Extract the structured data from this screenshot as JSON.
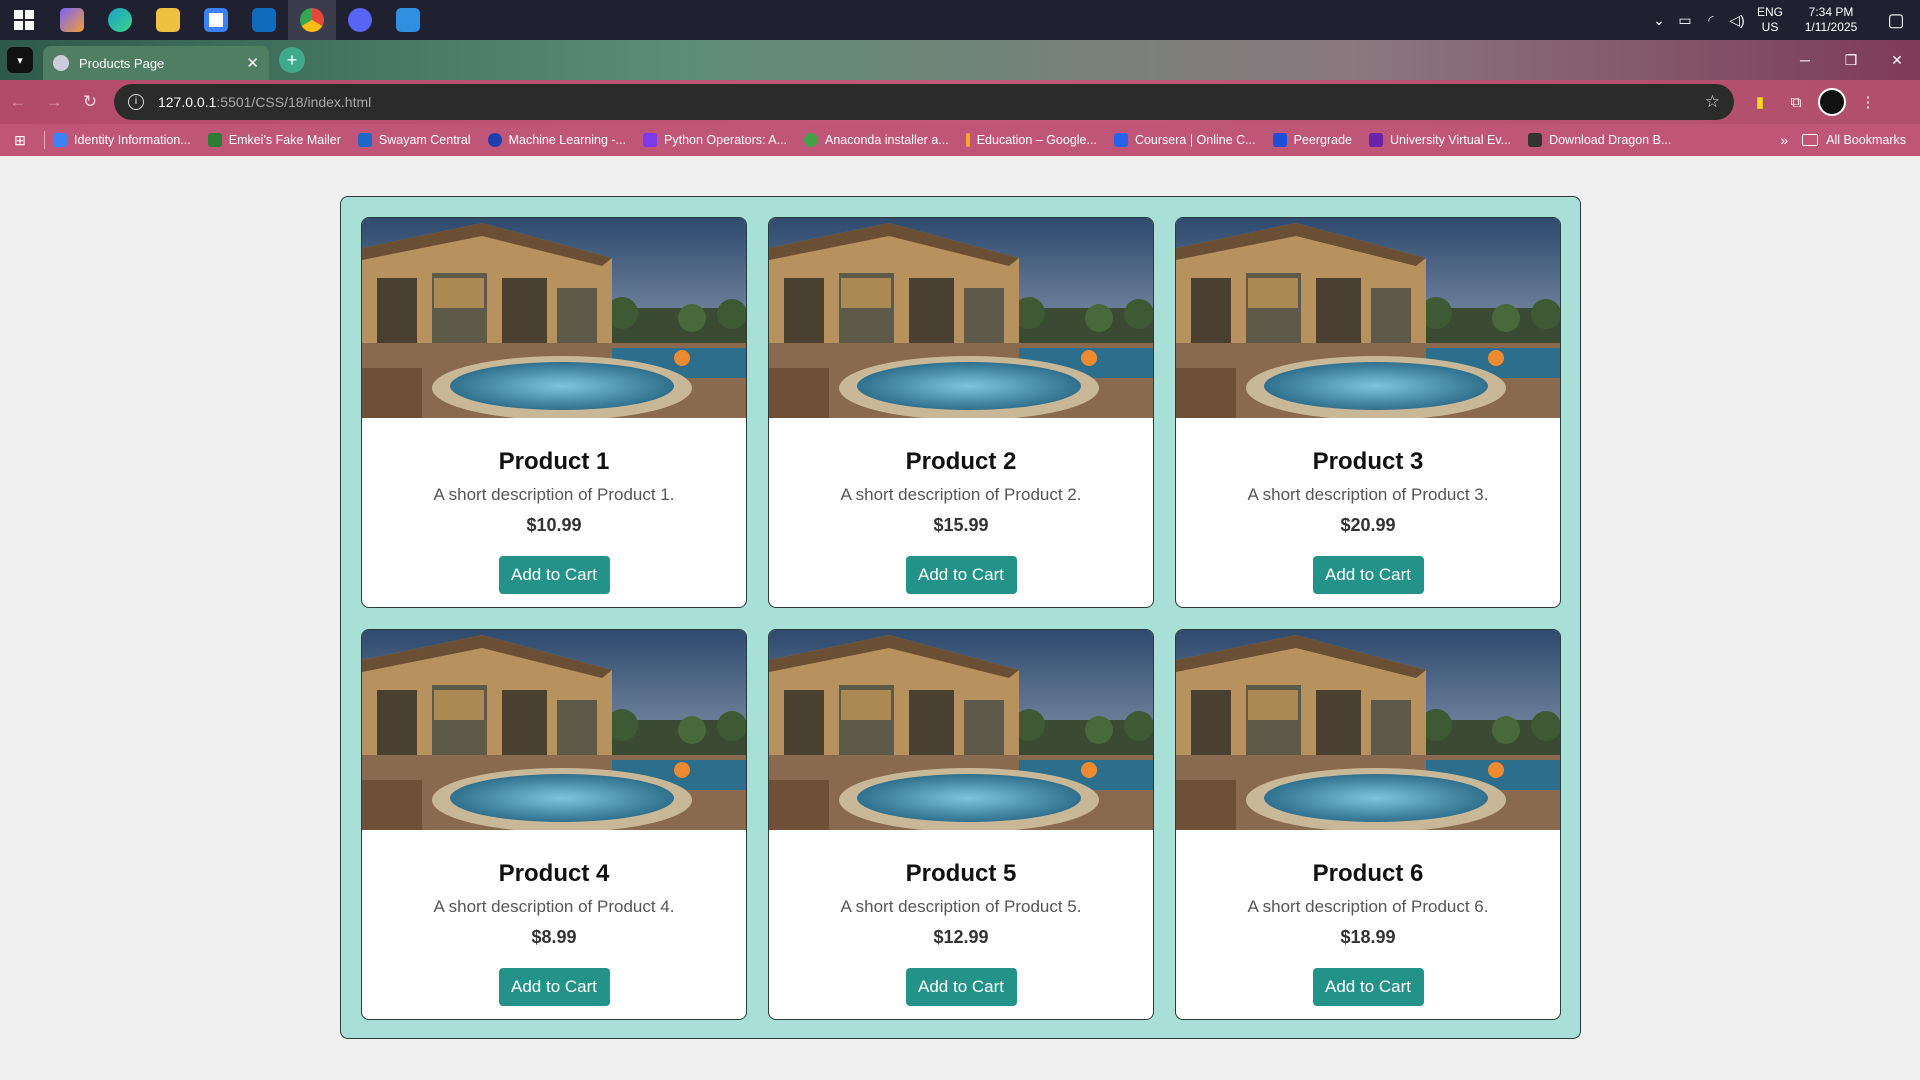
{
  "taskbar": {
    "apps": [
      {
        "name": "copilot-app",
        "color": "#7b61ff"
      },
      {
        "name": "edge-app",
        "color": "#1ba1c7"
      },
      {
        "name": "file-explorer-app",
        "color": "#f0c040"
      },
      {
        "name": "store-app",
        "color": "#3b82f6"
      },
      {
        "name": "outlook-app",
        "color": "#0f6cbd"
      },
      {
        "name": "chrome-app",
        "color": "#e8453c"
      },
      {
        "name": "discord-app",
        "color": "#5865f2"
      },
      {
        "name": "vscode-app",
        "color": "#2f8fe0"
      }
    ],
    "lang_top": "ENG",
    "lang_bottom": "US",
    "time": "7:34 PM",
    "date": "1/11/2025"
  },
  "browser": {
    "tab_title": "Products Page",
    "url_host": "127.0.0.1",
    "url_path": ":5501/CSS/18/index.html"
  },
  "bookmarks": {
    "items": [
      {
        "label": "Identity Information...",
        "color": "#3b82f6"
      },
      {
        "label": "Emkei's Fake Mailer",
        "color": "#2e7d32"
      },
      {
        "label": "Swayam Central",
        "color": "#1e66c8"
      },
      {
        "label": "Machine Learning -...",
        "color": "#1e40af"
      },
      {
        "label": "Python Operators: A...",
        "color": "#7c3aed"
      },
      {
        "label": "Anaconda installer a...",
        "color": "#43a047"
      },
      {
        "label": "Education – Google...",
        "color": "#f9a825"
      },
      {
        "label": "Coursera | Online C...",
        "color": "#2563eb"
      },
      {
        "label": "Peergrade",
        "color": "#1d4ed8"
      },
      {
        "label": "University Virtual Ev...",
        "color": "#6b21a8"
      },
      {
        "label": "Download Dragon B...",
        "color": "#333333"
      }
    ],
    "all_label": "All Bookmarks"
  },
  "products": [
    {
      "title": "Product 1",
      "description": "A short description of Product 1.",
      "price": "$10.99",
      "button": "Add to Cart"
    },
    {
      "title": "Product 2",
      "description": "A short description of Product 2.",
      "price": "$15.99",
      "button": "Add to Cart"
    },
    {
      "title": "Product 3",
      "description": "A short description of Product 3.",
      "price": "$20.99",
      "button": "Add to Cart"
    },
    {
      "title": "Product 4",
      "description": "A short description of Product 4.",
      "price": "$8.99",
      "button": "Add to Cart"
    },
    {
      "title": "Product 5",
      "description": "A short description of Product 5.",
      "price": "$12.99",
      "button": "Add to Cart"
    },
    {
      "title": "Product 6",
      "description": "A short description of Product 6.",
      "price": "$18.99",
      "button": "Add to Cart"
    }
  ],
  "colors": {
    "grid_background": "#a8e0d8",
    "button": "#23938a"
  }
}
